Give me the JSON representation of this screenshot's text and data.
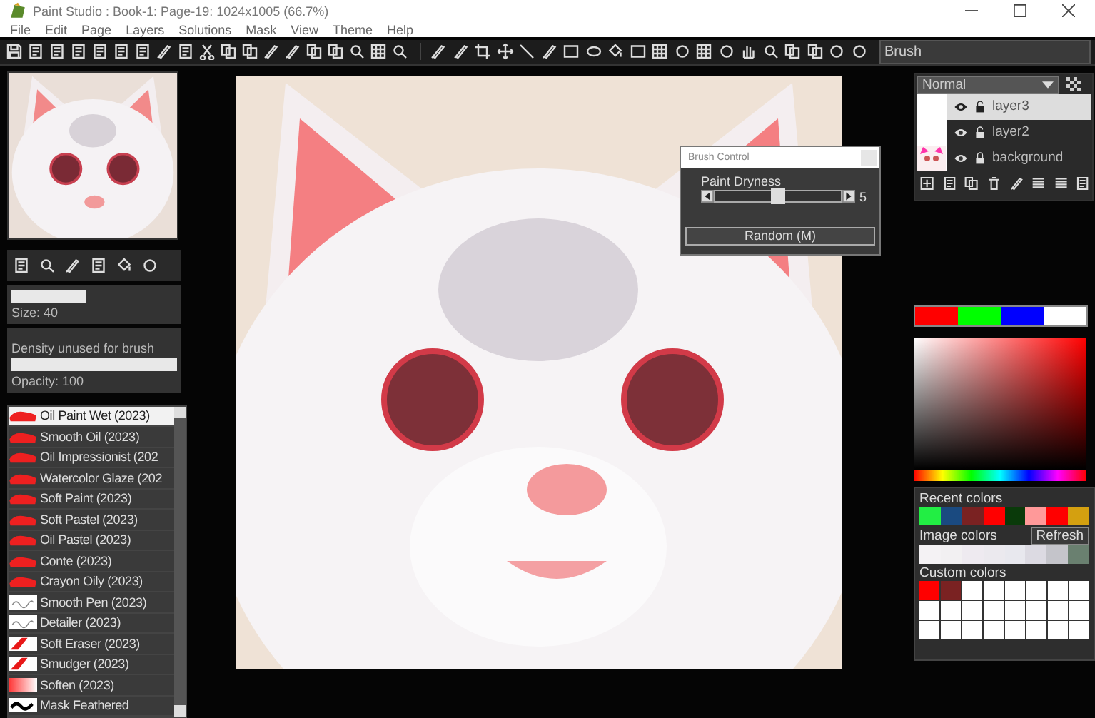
{
  "window": {
    "title": "Paint Studio : Book-1: Page-19: 1024x1005  (66.7%)"
  },
  "menu": [
    "File",
    "Edit",
    "Page",
    "Layers",
    "Solutions",
    "Mask",
    "View",
    "Theme",
    "Help"
  ],
  "tool_field": {
    "value": "Brush"
  },
  "brush_settings": {
    "size": {
      "level": 0.45,
      "label": "Size: 40"
    },
    "density_note": "Density unused for brush",
    "opacity": {
      "level": 1,
      "label": "Opacity: 100"
    }
  },
  "brushes": [
    {
      "name": "Oil Paint Wet (2023)",
      "kind": "stroke",
      "selected": true
    },
    {
      "name": "Smooth Oil (2023)",
      "kind": "stroke",
      "selected": false
    },
    {
      "name": "Oil Impressionist (202",
      "kind": "stroke",
      "selected": false
    },
    {
      "name": "Watercolor Glaze (202",
      "kind": "stroke",
      "selected": false
    },
    {
      "name": "Soft Paint (2023)",
      "kind": "stroke",
      "selected": false
    },
    {
      "name": "Soft Pastel (2023)",
      "kind": "stroke",
      "selected": false
    },
    {
      "name": "Oil Pastel (2023)",
      "kind": "stroke",
      "selected": false
    },
    {
      "name": "Conte (2023)",
      "kind": "stroke",
      "selected": false
    },
    {
      "name": "Crayon Oily (2023)",
      "kind": "stroke",
      "selected": false
    },
    {
      "name": "Smooth Pen (2023)",
      "kind": "pen",
      "selected": false
    },
    {
      "name": "Detailer (2023)",
      "kind": "pen",
      "selected": false
    },
    {
      "name": "Soft Eraser (2023)",
      "kind": "wedge",
      "selected": false
    },
    {
      "name": "Smudger (2023)",
      "kind": "wedge",
      "selected": false
    },
    {
      "name": "Soften (2023)",
      "kind": "fade",
      "selected": false
    },
    {
      "name": "Mask Feathered",
      "kind": "mask",
      "selected": false
    }
  ],
  "brush_control": {
    "title": "Brush Control",
    "label": "Paint Dryness",
    "level": 0.5,
    "reading": "5",
    "button": "Random (M)"
  },
  "layers": {
    "blend_mode": "Normal",
    "items": [
      {
        "name": "layer3",
        "selected": true,
        "visible": true,
        "locked": false
      },
      {
        "name": "layer2",
        "selected": false,
        "visible": true,
        "locked": false
      },
      {
        "name": "background",
        "selected": false,
        "visible": true,
        "locked": true
      }
    ]
  },
  "main_colors": [
    {
      "color": "#ff0000"
    },
    {
      "color": "#00ff00"
    },
    {
      "color": "#0000ff"
    },
    {
      "color": "#ffffff"
    }
  ],
  "recent_colors": {
    "title": "Recent colors",
    "items": [
      {
        "color": "#22ee44"
      },
      {
        "color": "#1a4a80"
      },
      {
        "color": "#7a2222"
      },
      {
        "color": "#ff0000"
      },
      {
        "color": "#0a3a0a"
      },
      {
        "color": "#ff9999"
      },
      {
        "color": "#ff0000"
      },
      {
        "color": "#d4a010"
      }
    ]
  },
  "image_colors": {
    "title": "Image colors",
    "button": "Refresh",
    "items": [
      {
        "color": "#f4f2f4"
      },
      {
        "color": "#f2f0f2"
      },
      {
        "color": "#eeeaf0"
      },
      {
        "color": "#ebe9ee"
      },
      {
        "color": "#e8e8ee"
      },
      {
        "color": "#dcdae2"
      },
      {
        "color": "#c4c4ca"
      },
      {
        "color": "#6a8070"
      }
    ]
  },
  "custom_colors": {
    "title": "Custom colors",
    "items": [
      {
        "color": "#ff0000"
      },
      {
        "color": "#7a2222"
      },
      {
        "color": "#ffffff"
      },
      {
        "color": "#ffffff"
      },
      {
        "color": "#ffffff"
      },
      {
        "color": "#ffffff"
      },
      {
        "color": "#ffffff"
      },
      {
        "color": "#ffffff"
      },
      {
        "color": "#ffffff"
      },
      {
        "color": "#ffffff"
      },
      {
        "color": "#ffffff"
      },
      {
        "color": "#ffffff"
      },
      {
        "color": "#ffffff"
      },
      {
        "color": "#ffffff"
      },
      {
        "color": "#ffffff"
      },
      {
        "color": "#ffffff"
      },
      {
        "color": "#ffffff"
      },
      {
        "color": "#ffffff"
      },
      {
        "color": "#ffffff"
      },
      {
        "color": "#ffffff"
      },
      {
        "color": "#ffffff"
      },
      {
        "color": "#ffffff"
      },
      {
        "color": "#ffffff"
      },
      {
        "color": "#ffffff"
      }
    ]
  }
}
